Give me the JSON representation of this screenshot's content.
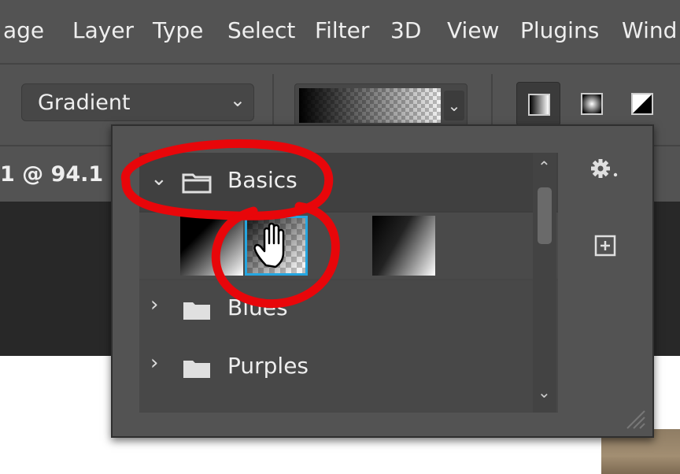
{
  "menubar": {
    "items": [
      "age",
      "Layer",
      "Type",
      "Select",
      "Filter",
      "3D",
      "View",
      "Plugins",
      "Wind"
    ]
  },
  "options_bar": {
    "tool_mode": "Gradient",
    "gradient_types": [
      "linear-gradient-icon",
      "radial-gradient-icon",
      "angle-gradient-icon"
    ]
  },
  "document": {
    "tab_label": "1 @ 94.1"
  },
  "gradient_presets": {
    "groups": [
      {
        "name": "Basics",
        "expanded": true
      },
      {
        "name": "Blues",
        "expanded": false
      },
      {
        "name": "Purples",
        "expanded": false
      }
    ],
    "selected_swatch_index": 1
  },
  "colors": {
    "panel_bg": "#535353",
    "selection_outline": "#25a6e0",
    "annotation_red": "#e8060a"
  }
}
